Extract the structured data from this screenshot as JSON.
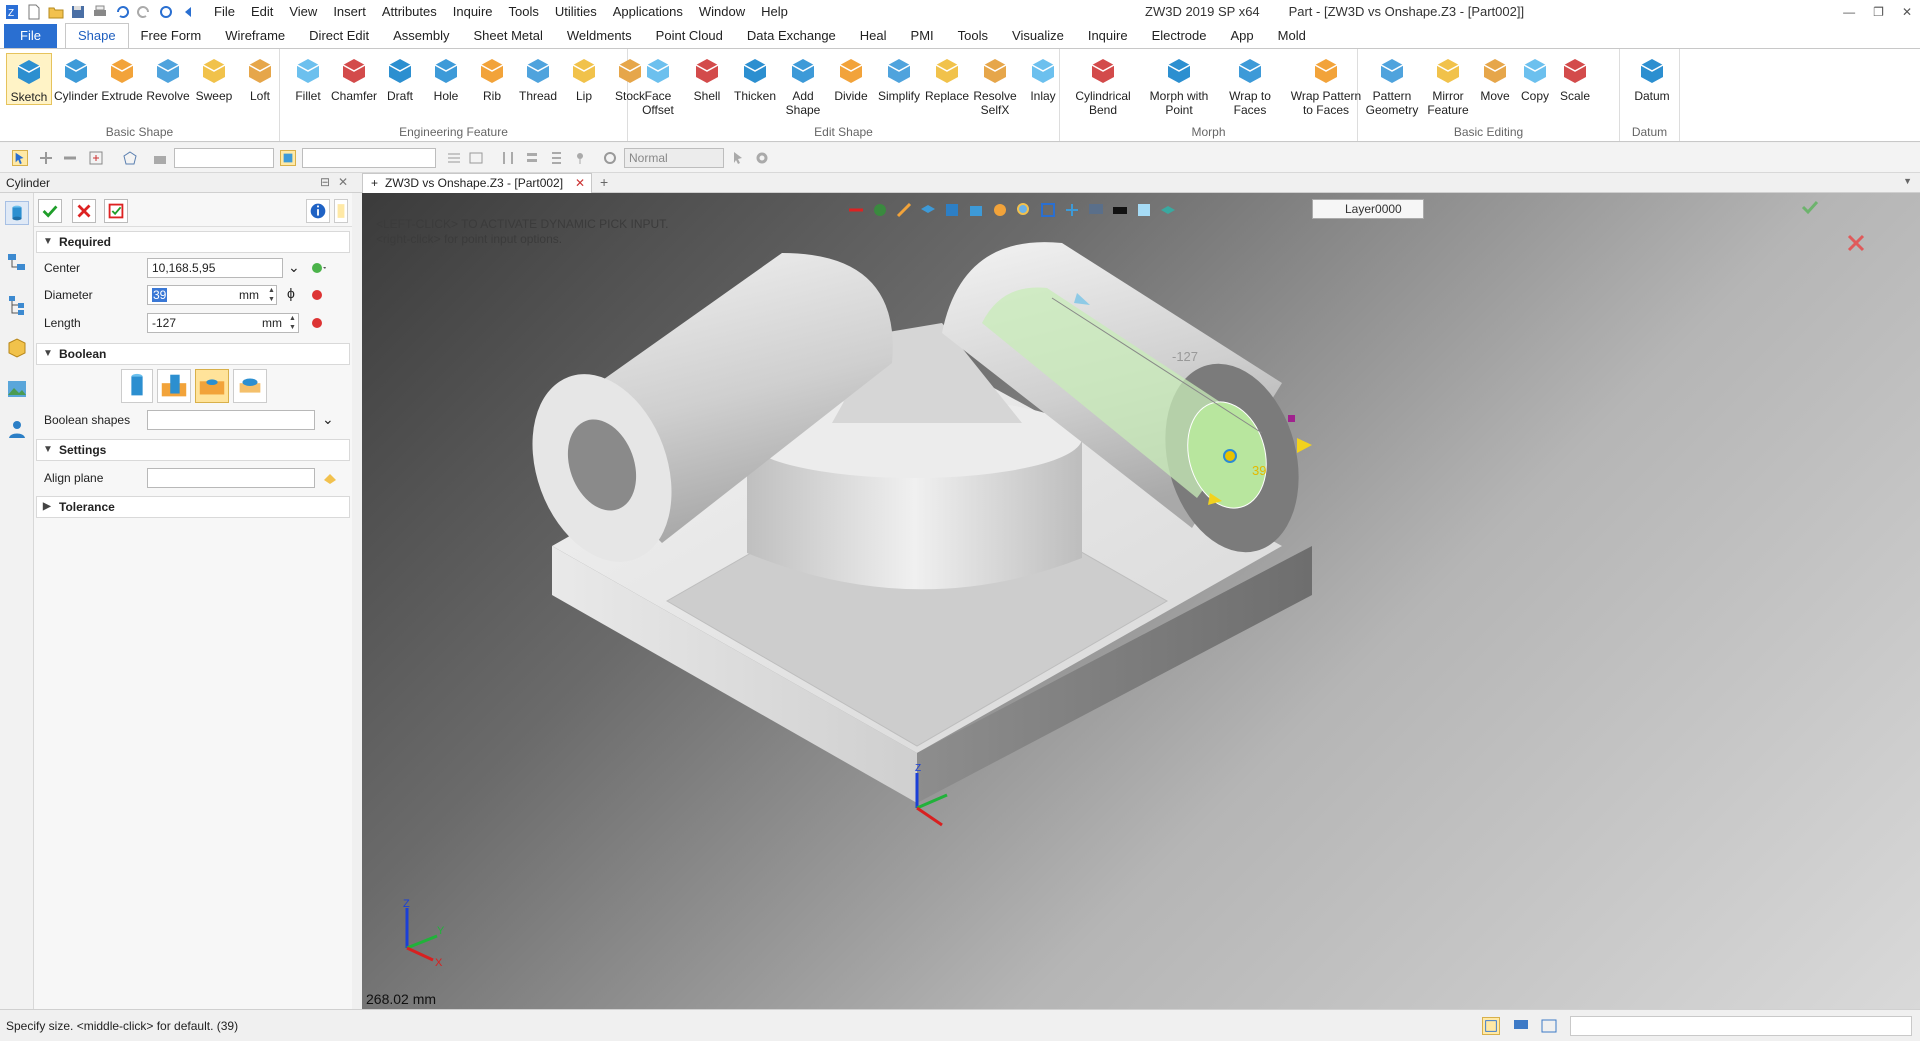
{
  "app": {
    "title": "ZW3D 2019 SP x64",
    "part_title": "Part - [ZW3D vs Onshape.Z3 - [Part002]]"
  },
  "menu": [
    "File",
    "Edit",
    "View",
    "Insert",
    "Attributes",
    "Inquire",
    "Tools",
    "Utilities",
    "Applications",
    "Window",
    "Help"
  ],
  "ribbon_tabs": [
    "File",
    "Shape",
    "Free Form",
    "Wireframe",
    "Direct Edit",
    "Assembly",
    "Sheet Metal",
    "Weldments",
    "Point Cloud",
    "Data Exchange",
    "Heal",
    "PMI",
    "Tools",
    "Visualize",
    "Inquire",
    "Electrode",
    "App",
    "Mold"
  ],
  "active_tab": "Shape",
  "ribbon_groups": [
    {
      "label": "Basic Shape",
      "buttons": [
        "Sketch",
        "Cylinder",
        "Extrude",
        "Revolve",
        "Sweep",
        "Loft"
      ]
    },
    {
      "label": "Engineering Feature",
      "buttons": [
        "Fillet",
        "Chamfer",
        "Draft",
        "Hole",
        "Rib",
        "Thread",
        "Lip",
        "Stock"
      ]
    },
    {
      "label": "Edit Shape",
      "buttons": [
        "Face\nOffset",
        "Shell",
        "Thicken",
        "Add\nShape",
        "Divide",
        "Simplify",
        "Replace",
        "Resolve\nSelfX",
        "Inlay"
      ]
    },
    {
      "label": "Morph",
      "buttons": [
        "Cylindrical\nBend",
        "Morph with\nPoint",
        "Wrap to\nFaces",
        "Wrap Pattern\nto Faces"
      ]
    },
    {
      "label": "Basic Editing",
      "buttons": [
        "Pattern\nGeometry",
        "Mirror\nFeature",
        "Move",
        "Copy",
        "Scale"
      ]
    },
    {
      "label": "Datum",
      "buttons": [
        "Datum"
      ]
    }
  ],
  "toolbar2": {
    "render_mode": "Normal"
  },
  "panel": {
    "title": "Cylinder",
    "sections": {
      "required": "Required",
      "boolean": "Boolean",
      "settings": "Settings",
      "tolerance": "Tolerance"
    },
    "fields": {
      "center_label": "Center",
      "center_value": "10,168.5,95",
      "diameter_label": "Diameter",
      "diameter_value": "39",
      "diameter_unit": "mm",
      "length_label": "Length",
      "length_value": "-127",
      "length_unit": "mm",
      "boolean_shapes_label": "Boolean shapes",
      "align_plane_label": "Align plane"
    }
  },
  "doc_tab": "ZW3D vs Onshape.Z3 - [Part002]",
  "viewport": {
    "hint_line1": "<LEFT-CLICK> TO ACTIVATE DYNAMIC PICK INPUT.",
    "hint_line2": "<right-click> for point input options.",
    "layer": "Layer0000",
    "dim_length": "-127",
    "dim_diameter": "39",
    "measure": "268.02 mm",
    "axis_labels": [
      "Z",
      "Y",
      "X"
    ]
  },
  "status": {
    "message": "Specify size.  <middle-click> for default. (39)"
  },
  "colors": {
    "file_tab": "#2a6fd1",
    "preview": "#c8ecb8",
    "ok_green": "#1f9e2a",
    "cancel_red": "#d22"
  }
}
